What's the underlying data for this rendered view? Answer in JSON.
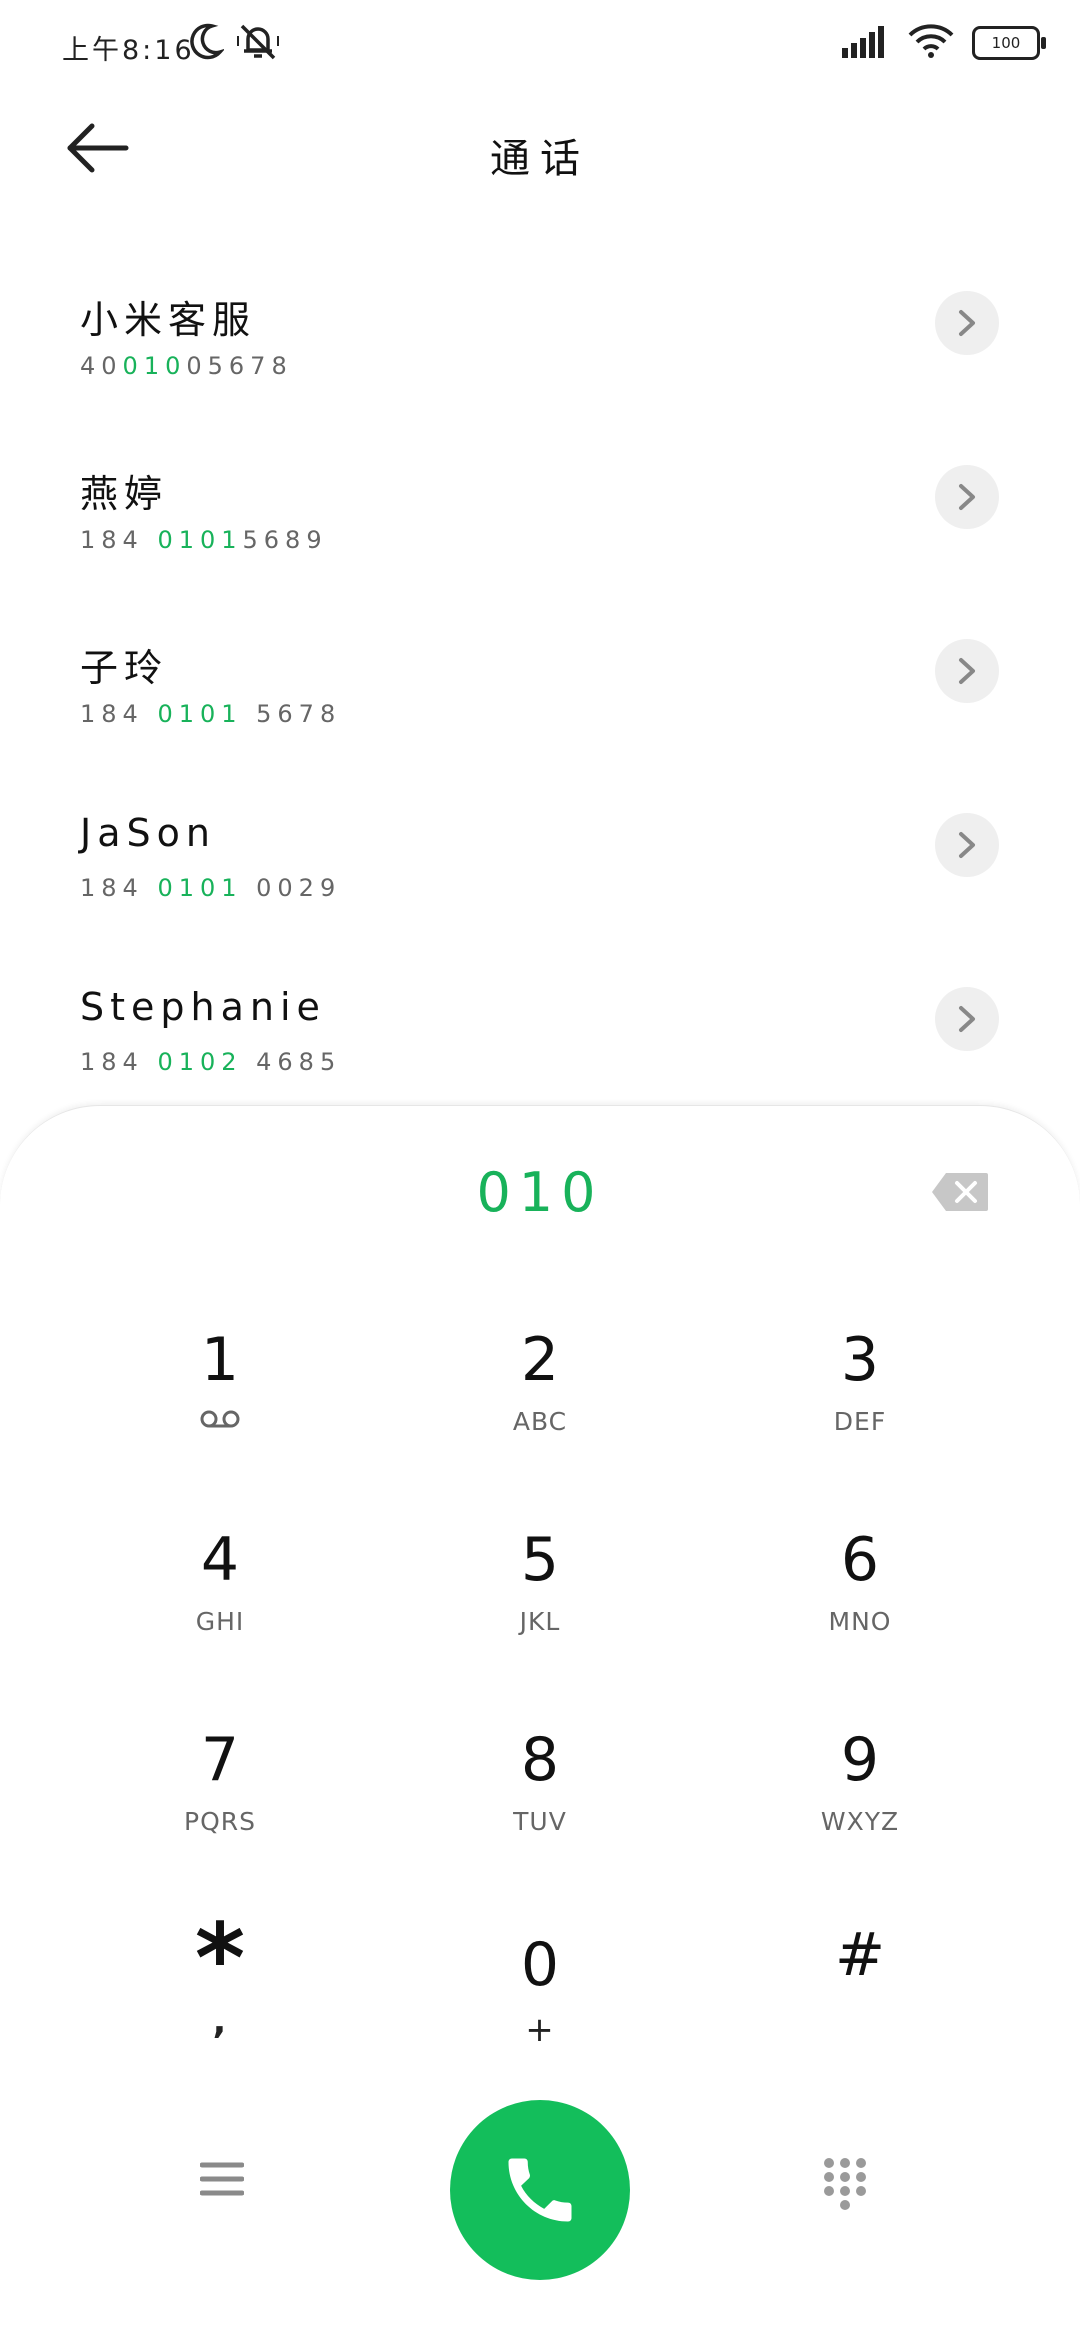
{
  "status_bar": {
    "time": "上午8:16",
    "battery": "100"
  },
  "header": {
    "title": "通话"
  },
  "contacts": [
    {
      "name": "小米客服",
      "number_pre": "40",
      "number_match": "010",
      "number_post": "05678"
    },
    {
      "name": "燕婷",
      "number_pre": "184 ",
      "number_match": "0101",
      "number_post": "5689"
    },
    {
      "name": "子玲",
      "number_pre": "184 ",
      "number_match": "0101",
      "number_post": " 5678"
    },
    {
      "name": "JaSon",
      "number_pre": "184 ",
      "number_match": "0101",
      "number_post": " 0029"
    },
    {
      "name": "Stephanie",
      "number_pre": "184 ",
      "number_match": "0102",
      "number_post": " 4685"
    }
  ],
  "dialer": {
    "input": "010",
    "keys": [
      {
        "digit": "1",
        "letters": ""
      },
      {
        "digit": "2",
        "letters": "ABC"
      },
      {
        "digit": "3",
        "letters": "DEF"
      },
      {
        "digit": "4",
        "letters": "GHI"
      },
      {
        "digit": "5",
        "letters": "JKL"
      },
      {
        "digit": "6",
        "letters": "MNO"
      },
      {
        "digit": "7",
        "letters": "PQRS"
      },
      {
        "digit": "8",
        "letters": "TUV"
      },
      {
        "digit": "9",
        "letters": "WXYZ"
      },
      {
        "digit": "*",
        "letters": ","
      },
      {
        "digit": "0",
        "letters": "+"
      },
      {
        "digit": "#",
        "letters": ""
      }
    ]
  },
  "colors": {
    "accent": "#18b25a",
    "call_button": "#13be5b"
  }
}
